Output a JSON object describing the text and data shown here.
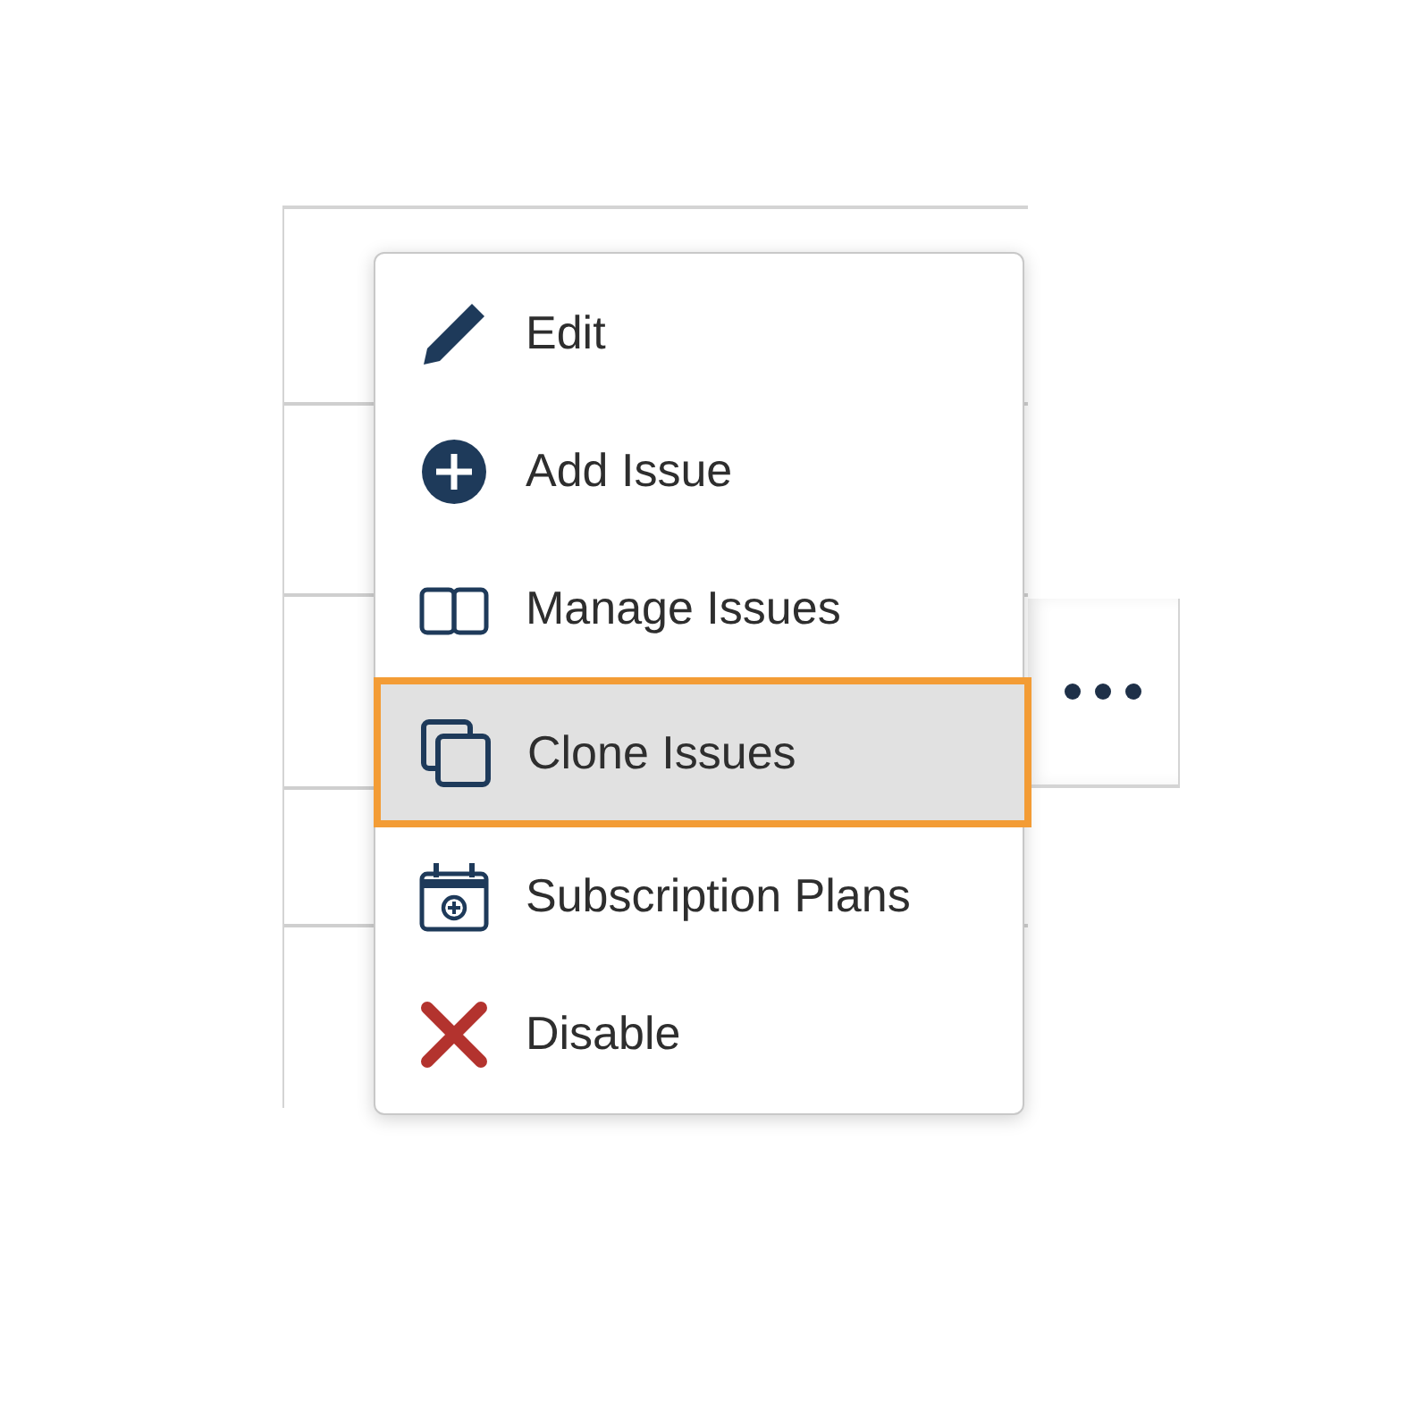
{
  "menu": {
    "items": [
      {
        "label": "Edit",
        "kind": "edit",
        "selected": false
      },
      {
        "label": "Add Issue",
        "kind": "add",
        "selected": false
      },
      {
        "label": "Manage Issues",
        "kind": "manage",
        "selected": false
      },
      {
        "label": "Clone Issues",
        "kind": "clone",
        "selected": true
      },
      {
        "label": "Subscription Plans",
        "kind": "subscription",
        "selected": false
      },
      {
        "label": "Disable",
        "kind": "disable",
        "selected": false
      }
    ]
  }
}
